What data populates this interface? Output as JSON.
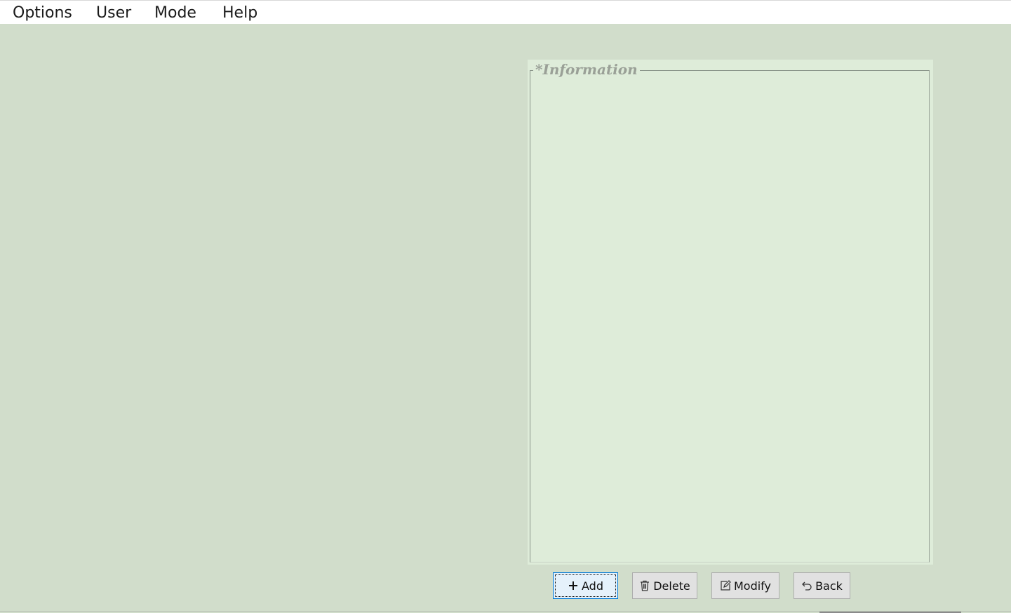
{
  "menu": {
    "items": [
      {
        "label": "Options"
      },
      {
        "label": "User"
      },
      {
        "label": "Mode"
      },
      {
        "label": "Help"
      }
    ]
  },
  "info_panel": {
    "legend": "*Information"
  },
  "buttons": {
    "add": {
      "label": "Add",
      "icon": "plus-icon"
    },
    "delete": {
      "label": "Delete",
      "icon": "trash-icon"
    },
    "modify": {
      "label": "Modify",
      "icon": "edit-icon"
    },
    "back": {
      "label": "Back",
      "icon": "undo-arrow-icon"
    }
  },
  "colors": {
    "background": "#d1ddcb",
    "panel": "#deecd9",
    "legend_text": "#9aa097",
    "focus_border": "#0078d7"
  }
}
